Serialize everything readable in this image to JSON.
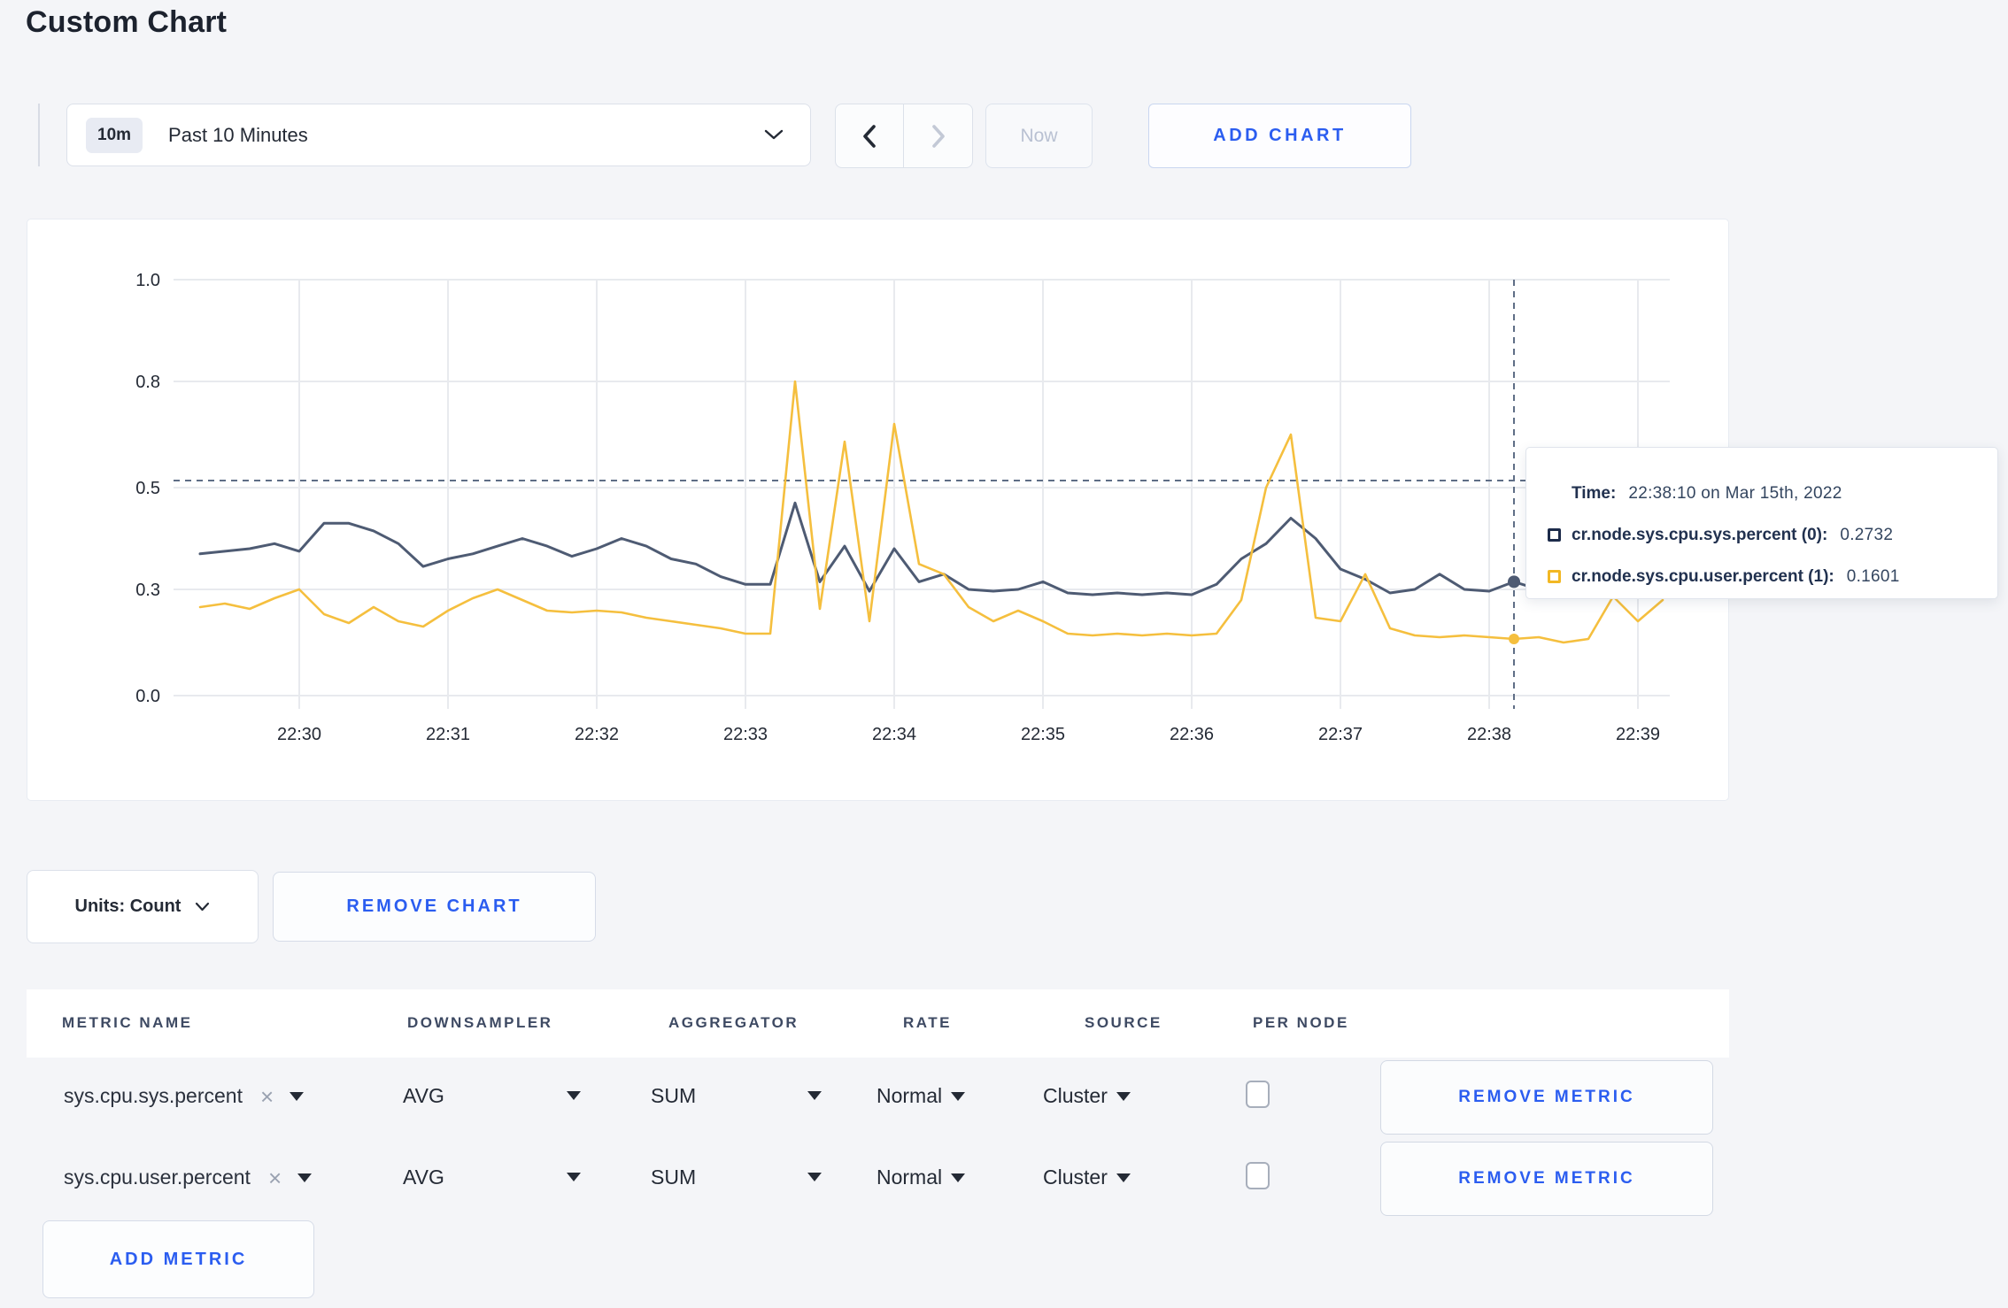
{
  "page": {
    "title": "Custom Chart"
  },
  "toolbar": {
    "range_badge": "10m",
    "range_label": "Past 10 Minutes",
    "now_label": "Now",
    "add_chart_label": "ADD CHART"
  },
  "chart_data": {
    "type": "line",
    "x_tick_labels": [
      "22:30",
      "22:31",
      "22:32",
      "22:33",
      "22:34",
      "22:35",
      "22:36",
      "22:37",
      "22:38",
      "22:39"
    ],
    "y_tick_values": [
      0,
      0.3,
      0.5,
      0.8,
      1.0
    ],
    "y_tick_labels": [
      "0.0",
      "0.3",
      "0.5",
      "0.8",
      "1.0"
    ],
    "ylim": [
      0,
      1.0
    ],
    "grid": true,
    "x_start_minutes_from_2230": -0.6667,
    "x_step_minutes": 0.16667,
    "series": [
      {
        "name": "cr.node.sys.cpu.sys.percent",
        "color": "#4e5b73",
        "values": [
          0.37,
          0.375,
          0.38,
          0.39,
          0.375,
          0.43,
          0.43,
          0.415,
          0.39,
          0.345,
          0.36,
          0.37,
          0.385,
          0.4,
          0.385,
          0.365,
          0.38,
          0.4,
          0.385,
          0.36,
          0.35,
          0.325,
          0.31,
          0.31,
          0.47,
          0.315,
          0.385,
          0.295,
          0.38,
          0.315,
          0.33,
          0.3,
          0.295,
          0.3,
          0.315,
          0.29,
          0.285,
          0.29,
          0.285,
          0.29,
          0.285,
          0.31,
          0.36,
          0.39,
          0.44,
          0.4,
          0.34,
          0.32,
          0.29,
          0.3,
          0.33,
          0.3,
          0.295,
          0.315,
          0.3,
          0.305,
          0.295,
          0.3,
          0.305,
          0.295
        ]
      },
      {
        "name": "cr.node.sys.cpu.user.percent",
        "color": "#f5bf3e",
        "values": [
          0.25,
          0.26,
          0.245,
          0.275,
          0.3,
          0.23,
          0.205,
          0.25,
          0.21,
          0.195,
          0.24,
          0.275,
          0.3,
          0.27,
          0.24,
          0.235,
          0.24,
          0.235,
          0.22,
          0.21,
          0.2,
          0.19,
          0.175,
          0.175,
          0.8,
          0.245,
          0.63,
          0.21,
          0.68,
          0.35,
          0.33,
          0.25,
          0.21,
          0.24,
          0.21,
          0.175,
          0.17,
          0.175,
          0.17,
          0.175,
          0.17,
          0.175,
          0.27,
          0.5,
          0.65,
          0.22,
          0.21,
          0.33,
          0.19,
          0.17,
          0.165,
          0.17,
          0.165,
          0.16,
          0.165,
          0.15,
          0.16,
          0.28,
          0.21,
          0.27
        ]
      }
    ],
    "crosshair": {
      "t_minutes": 8.1667,
      "hline_value": 0.52
    }
  },
  "tooltip": {
    "time_label": "Time:",
    "time_value": "22:38:10 on Mar 15th, 2022",
    "rows": [
      {
        "name": "cr.node.sys.cpu.sys.percent (0):",
        "value": "0.2732",
        "color": "#1c2b4a"
      },
      {
        "name": "cr.node.sys.cpu.user.percent (1):",
        "value": "0.1601",
        "color": "#f2b824"
      }
    ]
  },
  "units_row": {
    "units_label": "Units: Count",
    "remove_chart_label": "REMOVE CHART"
  },
  "metrics_table": {
    "headers": [
      "METRIC NAME",
      "DOWNSAMPLER",
      "AGGREGATOR",
      "RATE",
      "SOURCE",
      "PER NODE"
    ],
    "rows": [
      {
        "metric": "sys.cpu.sys.percent",
        "downsampler": "AVG",
        "aggregator": "SUM",
        "rate": "Normal",
        "source": "Cluster",
        "per_node_checked": false,
        "remove_label": "REMOVE METRIC"
      },
      {
        "metric": "sys.cpu.user.percent",
        "downsampler": "AVG",
        "aggregator": "SUM",
        "rate": "Normal",
        "source": "Cluster",
        "per_node_checked": false,
        "remove_label": "REMOVE METRIC"
      }
    ],
    "add_metric_label": "ADD METRIC"
  },
  "colors": {
    "accent_blue": "#2b5df0",
    "series_sys": "#4e5b73",
    "series_user": "#f5bf3e",
    "page_bg": "#f4f5f8",
    "gridline": "#e8eaee",
    "crosshair": "#5f6e86"
  }
}
